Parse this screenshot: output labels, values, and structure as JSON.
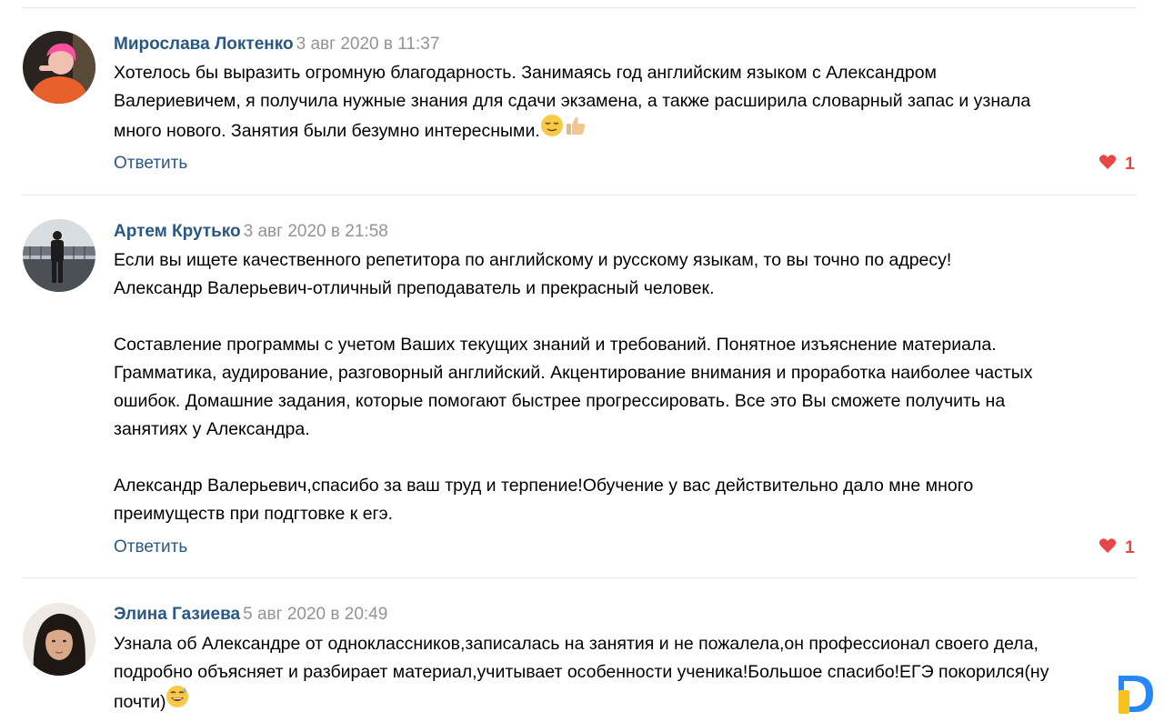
{
  "comments": [
    {
      "author": "Мирослава Локтенко",
      "date": "3 авг 2020 в 11:37",
      "lines": [
        "Хотелось бы выразить огромную благодарность. Занимаясь год английским языком с Александром",
        "Валериевичем, я получила нужные знания для сдачи экзамена, а также расширила словарный запас и узнала",
        "много нового. Занятия были безумно интересными."
      ],
      "reply_label": "Ответить",
      "likes": "1",
      "emojis": [
        "relieved-face-emoji",
        "thumbs-up-emoji"
      ]
    },
    {
      "author": "Артем Крутько",
      "date": "3 авг 2020 в 21:58",
      "lines": [
        "Если вы ищете качественного репетитора по английскому и русскому языкам, то вы точно по адресу!",
        "Александр Валерьевич-отличный преподаватель и прекрасный человек.",
        "",
        "Составление программы с учетом Ваших текущих знаний и требований. Понятное изъяснение материала.",
        "Грамматика, аудирование, разговорный английский. Акцентирование внимания и проработка наиболее частых",
        "ошибок. Домашние задания, которые помогают быстрее прогрессировать. Все это Вы сможете получить на",
        "занятиях у Александра.",
        "",
        "Александр Валерьевич,спасибо за ваш труд и терпение!Обучение у вас действительно дало мне много",
        "преимуществ при подгтовке к егэ."
      ],
      "reply_label": "Ответить",
      "likes": "1"
    },
    {
      "author": "Элина Газиева",
      "date": "5 авг 2020 в 20:49",
      "lines": [
        "Узнала об Александре от одноклассников,записалась на занятия и не пожалела,он профессионал своего дела,",
        "подробно объясняет и разбирает материал,учитывает особенности ученика!Большое спасибо!ЕГЭ покорился(ну",
        "почти)"
      ],
      "emojis": [
        "grinning-sweat-emoji"
      ]
    }
  ],
  "colors": {
    "author": "#2a5885",
    "date": "#939393",
    "like": "#e64646",
    "divider": "#e7e8ec",
    "logo_yellow": "#f7c21e",
    "logo_blue": "#2787f5"
  }
}
